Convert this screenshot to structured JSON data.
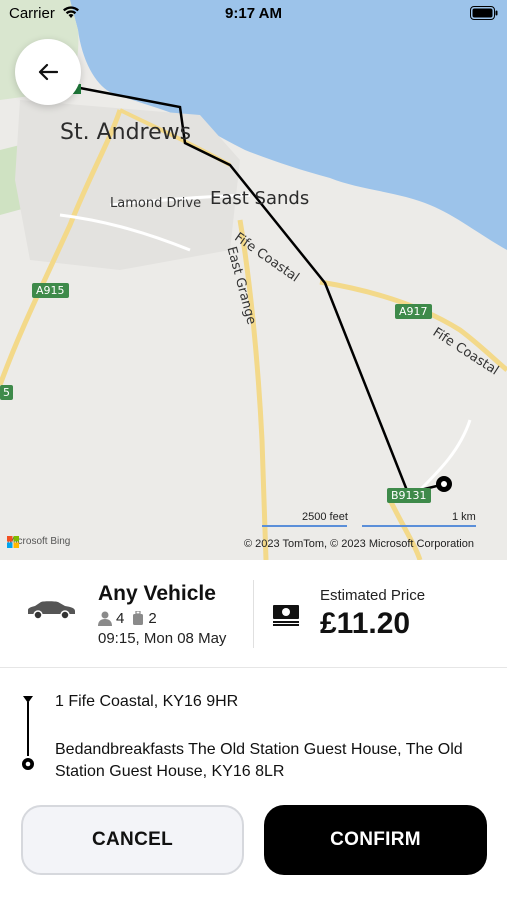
{
  "status_bar": {
    "carrier": "Carrier",
    "time": "9:17 AM"
  },
  "map": {
    "labels": {
      "town": "St. Andrews",
      "east_sands": "East Sands",
      "lamond_drive": "Lamond Drive",
      "fife_coastal_1": "Fife Coastal",
      "fife_coastal_2": "Fife Coastal",
      "east_grange": "East Grange",
      "road_a915": "A915",
      "road_a917": "A917",
      "road_b9131": "B9131",
      "road_edge": "5"
    },
    "scale_feet": "2500 feet",
    "scale_km": "1 km",
    "attribution_brand": "Microsoft Bing",
    "copyright": "© 2023 TomTom, © 2023 Microsoft Corporation",
    "colors": {
      "water": "#9cc3ea",
      "land": "#ecebe8",
      "road_major": "#f3d98a",
      "route": "#000000"
    }
  },
  "booking": {
    "vehicle_name": "Any Vehicle",
    "passengers": "4",
    "luggage": "2",
    "pickup_time": "09:15, Mon 08 May",
    "price_label": "Estimated Price",
    "price": "£11.20",
    "pickup_address": "1 Fife Coastal, KY16 9HR",
    "dropoff_address": "Bedandbreakfasts The Old Station Guest House, The Old Station Guest House, KY16 8LR"
  },
  "actions": {
    "cancel_label": "CANCEL",
    "confirm_label": "CONFIRM"
  },
  "icons": {
    "back": "arrow-left-icon",
    "car": "car-icon",
    "passenger": "person-icon",
    "luggage": "luggage-icon",
    "cash": "cash-icon"
  }
}
